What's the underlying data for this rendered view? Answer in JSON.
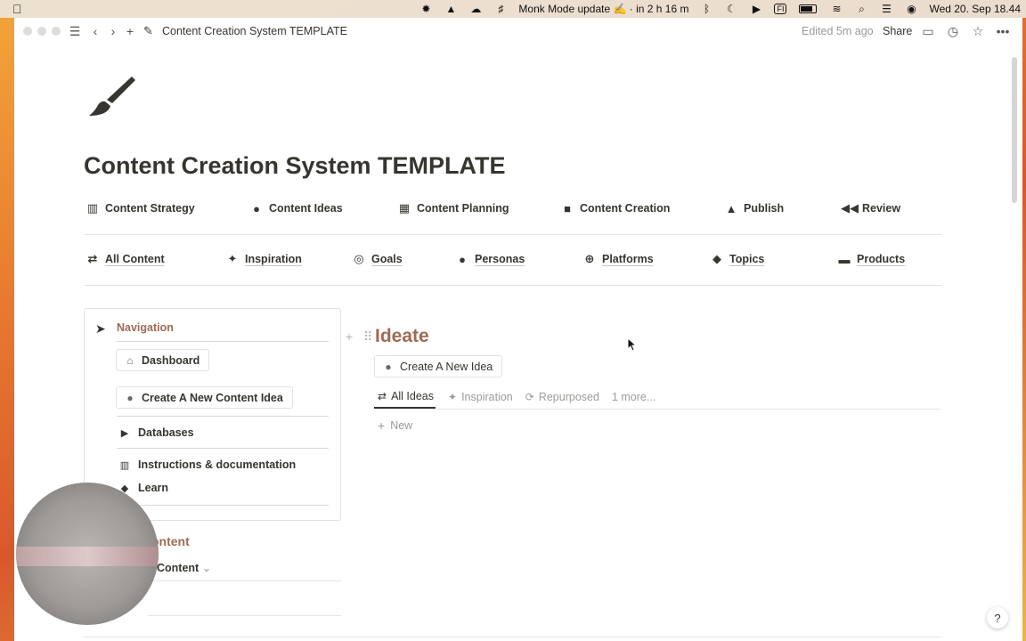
{
  "menubar": {
    "notification": "Monk Mode update ✍️ · in 2 h 16 m",
    "input_source": "FI",
    "datetime": "Wed 20. Sep  18.44"
  },
  "topbar": {
    "breadcrumb": "Content Creation System TEMPLATE",
    "edited": "Edited 5m ago",
    "share": "Share"
  },
  "page": {
    "title": "Content Creation System TEMPLATE"
  },
  "nav_row1": [
    {
      "label": "Content Strategy",
      "icon": "map-icon"
    },
    {
      "label": "Content Ideas",
      "icon": "lightbulb-icon"
    },
    {
      "label": "Content Planning",
      "icon": "book-icon"
    },
    {
      "label": "Content Creation",
      "icon": "video-camera-icon"
    },
    {
      "label": "Publish",
      "icon": "rocket-icon"
    },
    {
      "label": "Review",
      "icon": "rewind-icon"
    }
  ],
  "nav_row2": [
    {
      "label": "All Content",
      "icon": "arrows-icon"
    },
    {
      "label": "Inspiration",
      "icon": "magic-wand-icon"
    },
    {
      "label": "Goals",
      "icon": "target-icon"
    },
    {
      "label": "Personas",
      "icon": "person-icon"
    },
    {
      "label": "Platforms",
      "icon": "globe-icon"
    },
    {
      "label": "Topics",
      "icon": "shapes-icon"
    },
    {
      "label": "Products",
      "icon": "cart-icon"
    }
  ],
  "card": {
    "title": "Navigation",
    "dashboard": "Dashboard",
    "create_idea": "Create A New Content Idea",
    "databases": "Databases",
    "instructions": "Instructions & documentation",
    "learn": "Learn"
  },
  "below": {
    "heading": "ontent",
    "sub": "Content"
  },
  "ideate": {
    "heading": "Ideate",
    "create_button": "Create A New Idea",
    "views": [
      "All Ideas",
      "Inspiration",
      "Repurposed",
      "1 more..."
    ],
    "new": "New"
  },
  "help": "?"
}
